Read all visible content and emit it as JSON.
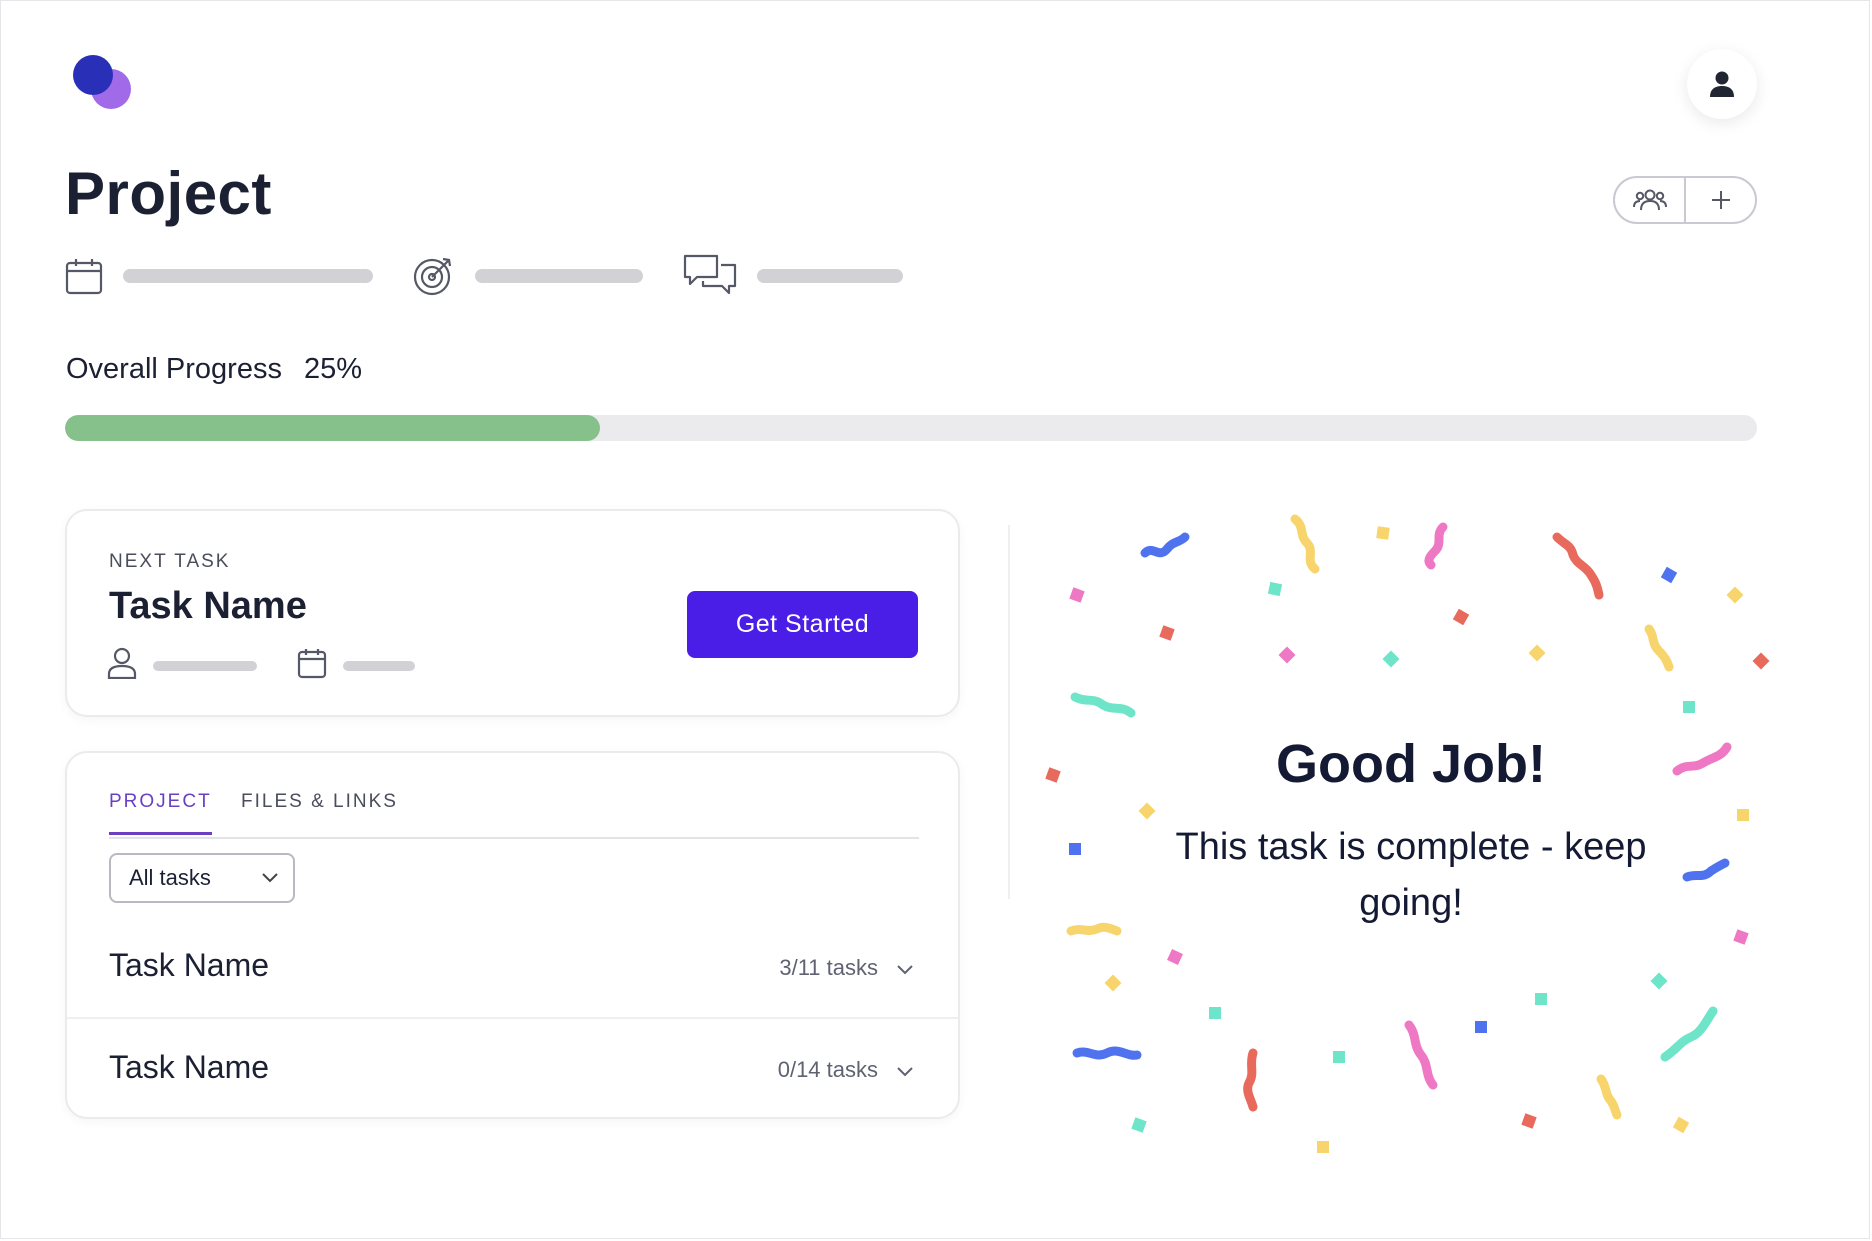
{
  "header": {
    "logo_icon": "overlapping-circles-logo",
    "profile_icon": "user-icon",
    "page_title": "Project",
    "team_icon": "team-icon",
    "add_icon": "plus-icon"
  },
  "meta": {
    "icons": [
      "calendar-icon",
      "target-icon",
      "chat-bubbles-icon"
    ]
  },
  "progress": {
    "label": "Overall Progress",
    "percent_text": "25%",
    "value": 0.316
  },
  "next_task": {
    "section_label": "NEXT TASK",
    "title": "Task Name",
    "button_label": "Get Started",
    "button_color": "#4a1ee6"
  },
  "tasks_panel": {
    "tabs": [
      {
        "label": "PROJECT",
        "active": true
      },
      {
        "label": "FILES & LINKS",
        "active": false
      }
    ],
    "filter": {
      "selected": "All tasks"
    },
    "rows": [
      {
        "name": "Task Name",
        "count": "3/11 tasks"
      },
      {
        "name": "Task Name",
        "count": "0/14 tasks"
      }
    ]
  },
  "celebration": {
    "title": "Good Job!",
    "message": "This task is complete - keep going!"
  },
  "colors": {
    "accent": "#4a1ee6",
    "progress_fill": "#86c18c",
    "tab_active": "#6a3fc4"
  }
}
